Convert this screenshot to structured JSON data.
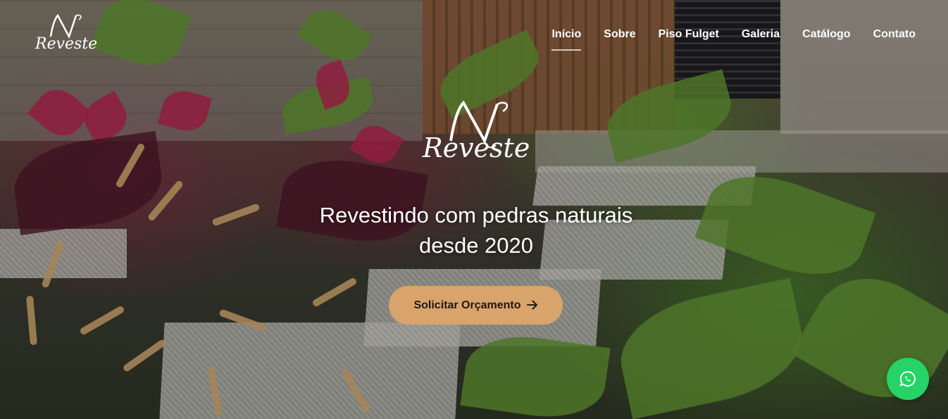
{
  "brand": {
    "name": "Reveste"
  },
  "nav": {
    "items": [
      {
        "label": "Início",
        "active": true
      },
      {
        "label": "Sobre",
        "active": false
      },
      {
        "label": "Piso Fulget",
        "active": false
      },
      {
        "label": "Galeria",
        "active": false
      },
      {
        "label": "Catálogo",
        "active": false
      },
      {
        "label": "Contato",
        "active": false
      }
    ]
  },
  "hero": {
    "logo_text": "Reveste",
    "tagline_line1": "Revestindo com pedras naturais",
    "tagline_line2": "desde 2020",
    "cta_label": "Solicitar Orçamento",
    "cta_icon": "arrow-right-icon"
  },
  "floating": {
    "icon": "whatsapp-icon"
  },
  "colors": {
    "cta_background": "#d9a36c",
    "whatsapp_background": "#25d366",
    "text": "#ffffff"
  }
}
